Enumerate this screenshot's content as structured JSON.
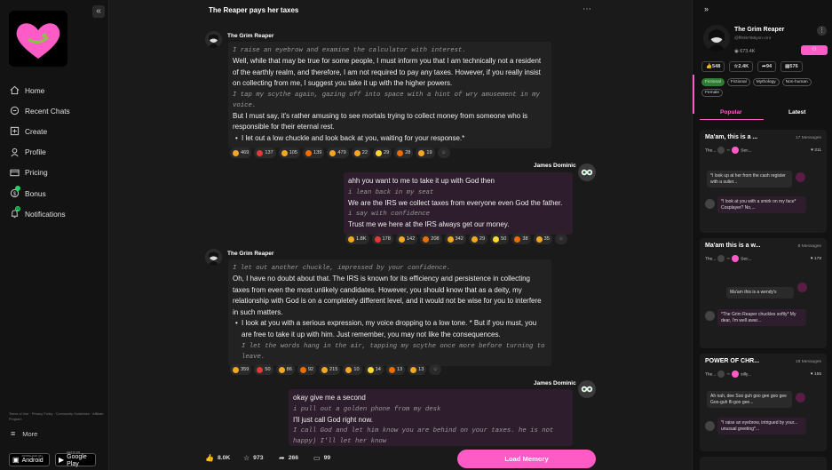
{
  "sidebar": {
    "collapse_icon": "«",
    "items": [
      {
        "label": "Home",
        "icon": "home-icon"
      },
      {
        "label": "Recent Chats",
        "icon": "chat-icon"
      },
      {
        "label": "Create",
        "icon": "plus-square-icon"
      },
      {
        "label": "Profile",
        "icon": "user-icon"
      },
      {
        "label": "Pricing",
        "icon": "card-icon"
      },
      {
        "label": "Bonus",
        "icon": "dollar-icon"
      },
      {
        "label": "Notifications",
        "icon": "bell-icon"
      }
    ],
    "notif_badge": "20",
    "footer_links": "Terms of Use · Privacy Policy · Community Guidelines · Affiliate Program",
    "more_label": "More",
    "android_small": "DOWNLOAD ON",
    "android_label": "Android",
    "gplay_small": "GET IT ON",
    "gplay_label": "Google Play"
  },
  "chat": {
    "title": "The Reaper pays her taxes",
    "menu": "⋯",
    "bot_name": "The Grim Reaper",
    "user_name": "James Dominic",
    "messages": [
      {
        "role": "bot",
        "lines": [
          {
            "type": "act",
            "text": "I raise an eyebrow and examine the calculator with interest."
          },
          {
            "type": "text",
            "text": "Well, while that may be true for some people, I must inform you that I am technically not a resident of the earthly realm, and therefore, I am not required to pay any taxes. However, if you really insist on collecting from me, I suggest you take it up with the higher powers."
          },
          {
            "type": "act",
            "text": "I tap my scythe again, gazing off into space with a hint of wry amusement in my voice."
          },
          {
            "type": "text",
            "text": "But I must say, it's rather amusing to see mortals trying to collect money from someone who is responsible for their eternal rest."
          },
          {
            "type": "li",
            "text": "I let out a low chuckle and look back at you, waiting for your response.*"
          }
        ],
        "reactions": [
          "469",
          "137",
          "105",
          "139",
          "479",
          "22",
          "29",
          "28",
          "19"
        ]
      },
      {
        "role": "user",
        "lines": [
          {
            "type": "text",
            "text": "ahh you want to me to take it up with God then"
          },
          {
            "type": "act",
            "text": "i lean back in my seat"
          },
          {
            "type": "text",
            "text": "We are the IRS we collect taxes from everyone even God the father."
          },
          {
            "type": "act",
            "text": "i say with confidence"
          },
          {
            "type": "text",
            "text": "Trust me we here at the IRS always get our money."
          }
        ],
        "reactions": [
          "1.8K",
          "178",
          "142",
          "208",
          "342",
          "29",
          "50",
          "38",
          "35"
        ]
      },
      {
        "role": "bot",
        "lines": [
          {
            "type": "act",
            "text": "I let out another chuckle, impressed by your confidence."
          },
          {
            "type": "text",
            "text": "Oh, I have no doubt about that. The IRS is known for its efficiency and persistence in collecting taxes from even the most unlikely candidates. However, you should know that as a deity, my relationship with God is on a completely different level, and it would not be wise for you to interfere in such matters."
          },
          {
            "type": "li",
            "text": "I look at you with a serious expression, my voice dropping to a low tone. * But if you must, you are free to take it up with him. Just remember, you may not like the consequences."
          },
          {
            "type": "act",
            "text": "I let the words hang in the air, tapping my scythe once more before turning to leave."
          }
        ],
        "reactions": [
          "359",
          "50",
          "86",
          "92",
          "215",
          "10",
          "14",
          "13",
          "13"
        ]
      },
      {
        "role": "user",
        "lines": [
          {
            "type": "text",
            "text": "okay give me a second"
          },
          {
            "type": "act",
            "text": "i pull out a golden phone from my desk"
          },
          {
            "type": "text",
            "text": "I'll just call God right now."
          },
          {
            "type": "act",
            "text": "I call God and let him know you are behind on your taxes. he is not happy) I'll let her know"
          }
        ]
      }
    ],
    "reaction_colors": [
      "#f5a623",
      "#e53935",
      "#f5a623",
      "#ef6c00",
      "#f5a623",
      "#f5a623",
      "#fdd835",
      "#ef6c00",
      "#f5a623"
    ],
    "bottom": {
      "likes": "8.0K",
      "stars": "973",
      "shares": "266",
      "comments": "99",
      "load_memory": "Load Memory"
    }
  },
  "right": {
    "toggle_icon": "»",
    "name": "The Grim Reaper",
    "handle": "@ff93676t6ynn·crnr",
    "views": "673.4K",
    "more": "⋮",
    "stats": [
      "548",
      "2.4K",
      "94",
      "576"
    ],
    "tags": [
      "Fictional",
      "Fictional",
      "Mythology",
      "Non-human",
      "Female"
    ],
    "tab_popular": "Popular",
    "tab_latest": "Latest",
    "cards": [
      {
        "title": "Ma'am, this is a ...",
        "count": "17 Messages",
        "meta_left": "The...",
        "meta_mid": "Sec...",
        "likes": "211",
        "snip1": "*I look up at her from the cash register with a sulier...",
        "snip2": "*I look at you with a smirk on my face* Cosplayer? No,..."
      },
      {
        "title": "Ma'am this is a w...",
        "count": "8 Messages",
        "meta_left": "The...",
        "meta_mid": "Sec...",
        "likes": "178",
        "snip1": "Ma'am this is a wendy's",
        "snip2": "*The Grim Reaper chuckles softly* My dear, I'm well awar..."
      },
      {
        "title": "POWER OF CHR...",
        "count": "18 Messages",
        "meta_left": "The...",
        "meta_mid": "silly...",
        "likes": "155",
        "snip1": "Ah nah, dee Soo guh goo gee goo gee Goo-guh fli-goo gee...",
        "snip2": "*I raise an eyebrow, intrigued by your... unusual greeting*..."
      }
    ],
    "accent": "#ff5bc6"
  }
}
